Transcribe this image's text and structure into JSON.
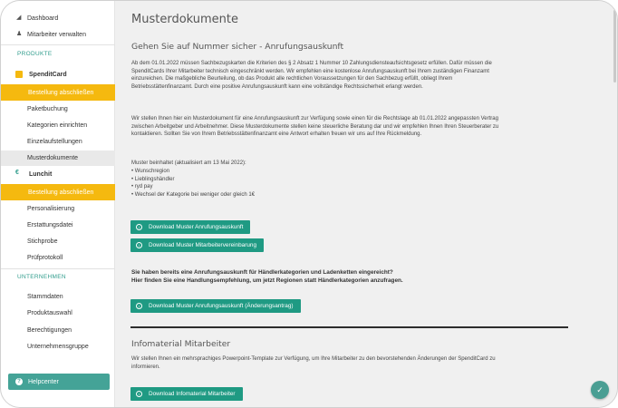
{
  "sidebar": {
    "dashboard": "Dashboard",
    "mitarbeiter": "Mitarbeiter verwalten",
    "section_produkte": "PRODUKTE",
    "spenditcard": "SpenditCard",
    "spendit_items": [
      "Bestellung abschließen",
      "Paketbuchung",
      "Kategorien einrichten",
      "Einzelaufstellungen",
      "Musterdokumente"
    ],
    "lunchit": "Lunchit",
    "lunchit_items": [
      "Bestellung abschließen",
      "Personalisierung",
      "Erstattungsdatei",
      "Stichprobe",
      "Prüfprotokoll"
    ],
    "section_unternehmen": "UNTERNEHMEN",
    "unternehmen_items": [
      "Stammdaten",
      "Produktauswahl",
      "Berechtigungen",
      "Unternehmensgruppe"
    ],
    "helpcenter": "Helpcenter"
  },
  "main": {
    "title": "Musterdokumente",
    "section1_heading": "Gehen Sie auf Nummer sicher - Anrufungsauskunft",
    "para1": "Ab dem 01.01.2022 müssen Sachbezugskarten die Kriterien des § 2 Absatz 1 Nummer 10 Zahlungsdiensteaufsichtsgesetz erfüllen. Dafür müssen die SpenditCards Ihrer Mitarbeiter technisch eingeschränkt werden. Wir empfehlen eine kostenlose Anrufungsauskunft bei Ihrem zuständigen Finanzamt einzureichen. Die maßgebliche Beurteilung, ob das Produkt alle rechtlichen Voraussetzungen für den Sachbezug erfüllt, obliegt Ihrem Betriebsstättenfinanzamt. Durch eine positive Anrufungsauskunft kann eine vollständige Rechtssicherheit erlangt werden.",
    "para2": "Wir stellen Ihnen hier ein Musterdokument für eine Anrufungsauskunft zur Verfügung sowie einen für die Rechtslage ab 01.01.2022 angepassten Vertrag zwischen Arbeitgeber und Arbeitnehmer. Diese Musterdokumente stellen keine steuerliche Beratung dar und wir empfehlen Ihnen Ihren Steuerberater zu kontaktieren. Sollten Sie von Ihrem Betriebsstättenfinanzamt eine Antwort erhalten freuen wir uns auf Ihre Rückmeldung.",
    "muster_intro": "Muster beinhaltet (aktualisiert am 13 Mai 2022):",
    "muster_items": [
      "Wunschregion",
      "Lieblingshändler",
      "ryd pay",
      "Wechsel der Kategorie bei weniger oder gleich 1€"
    ],
    "btn_anrufung": "Download Muster Anrufungsauskunft",
    "btn_vereinbarung": "Download Muster Mitarbeitervereinbarung",
    "question1": "Sie haben bereits eine Anrufungsauskunft für Händlerkategorien und Ladenketten eingereicht?",
    "question2": "Hier finden Sie eine Handlungsempfehlung, um jetzt Regionen statt Händlerkategorien anzufragen.",
    "btn_aenderung": "Download Muster Anrufungsauskunft (Änderungsantrag)",
    "section2_heading": "Infomaterial Mitarbeiter",
    "para3": "Wir stellen Ihnen ein mehrsprachiges Powerpoint-Template zur Verfügung, um Ihre Mitarbeiter zu den bevorstehenden Änderungen der SpenditCard zu informieren.",
    "btn_infomaterial": "Download Infomaterial Mitarbeiter"
  },
  "colors": {
    "accent_yellow": "#f5b90f",
    "accent_green": "#1f9a83",
    "helpcenter_teal": "#44a397"
  }
}
